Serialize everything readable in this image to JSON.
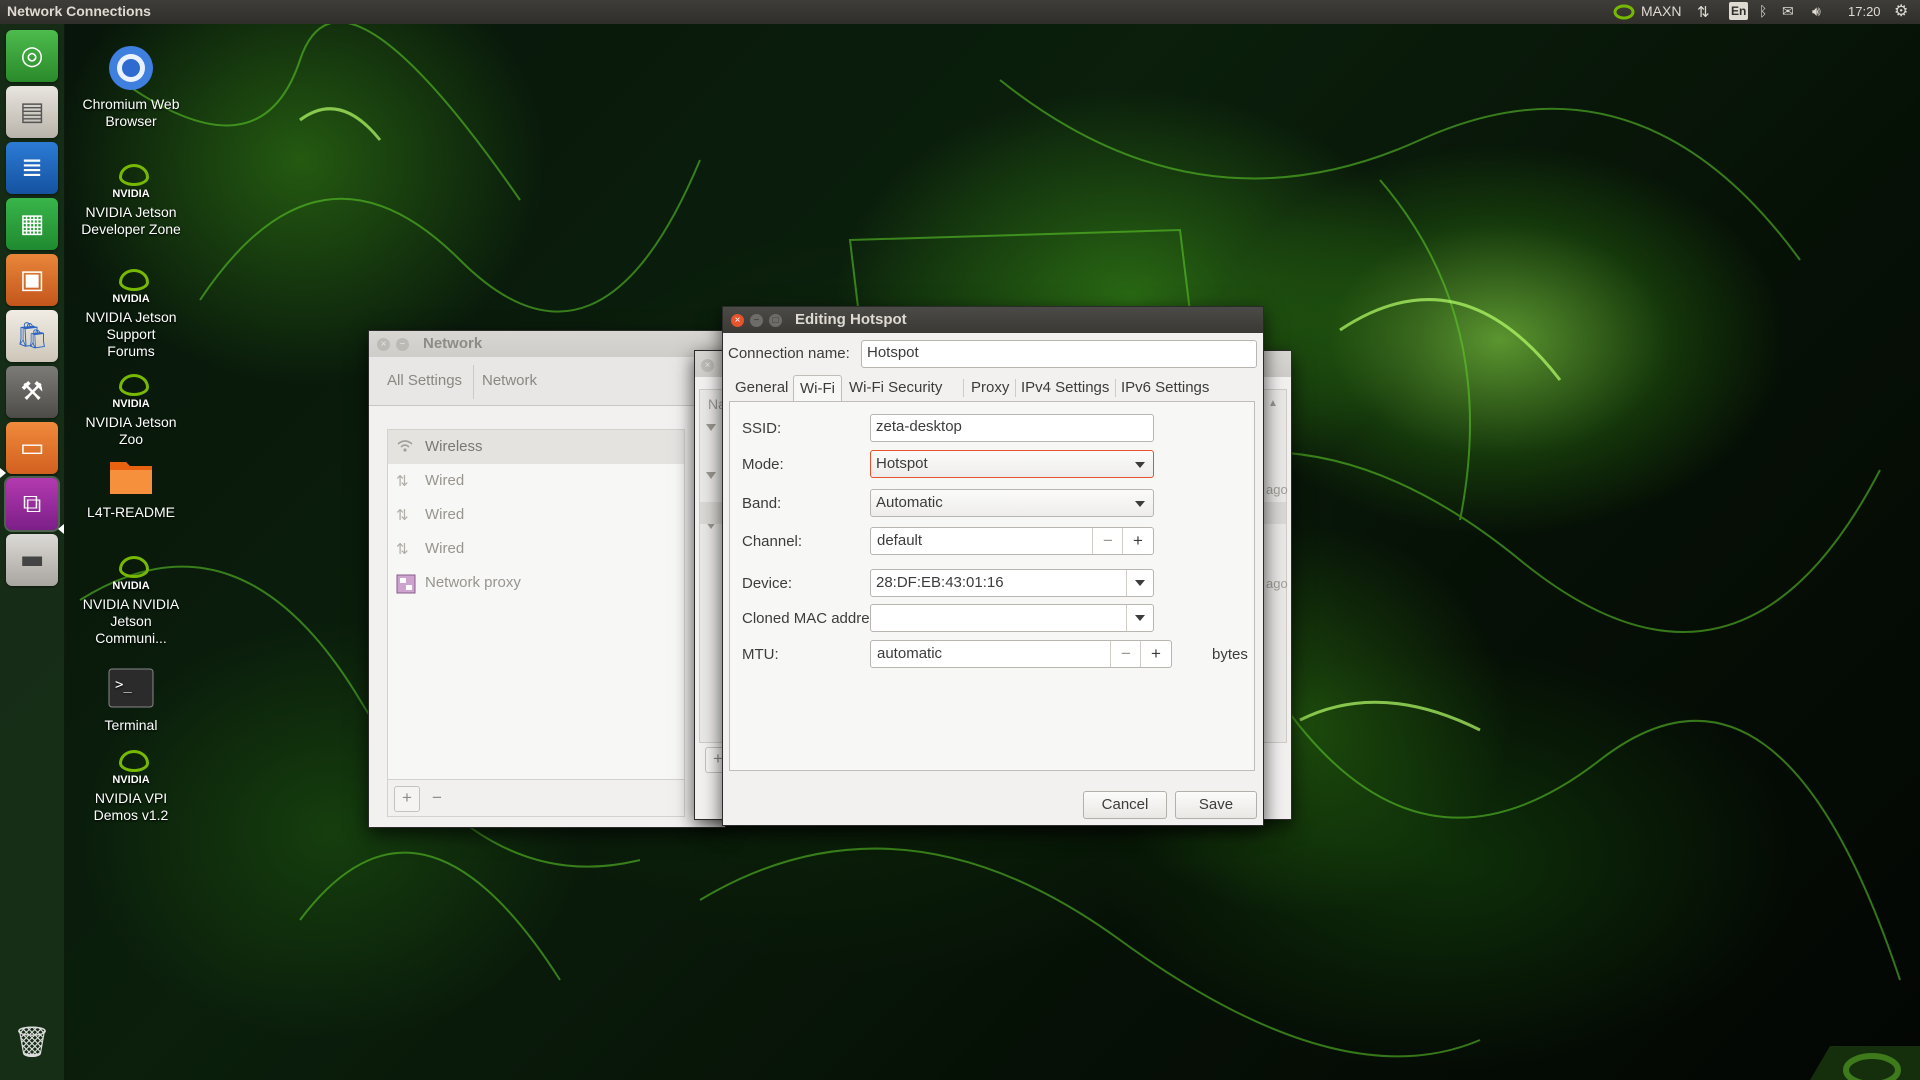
{
  "top_panel": {
    "app_title": "Network Connections",
    "power_mode": "MAXN",
    "keyboard_layout": "En",
    "clock": "17:20",
    "icons": [
      "nvidia-icon",
      "network-updown-icon",
      "keyboard-icon",
      "bluetooth-icon",
      "mail-icon",
      "volume-icon",
      "gear-icon"
    ]
  },
  "launcher": {
    "items": [
      "ubuntu-dash",
      "file-cabinet",
      "writer",
      "calc",
      "impress",
      "software-center",
      "system-settings",
      "file-manager",
      "network-connections",
      "drive"
    ],
    "trash": "trash"
  },
  "desktop_icons": [
    {
      "label": "Chromium Web Browser",
      "icon": "chromium-icon"
    },
    {
      "label": "NVIDIA Jetson Developer Zone",
      "icon": "nvidia-icon"
    },
    {
      "label": "NVIDIA Jetson Support Forums",
      "icon": "nvidia-icon"
    },
    {
      "label": "NVIDIA Jetson Zoo",
      "icon": "nvidia-icon"
    },
    {
      "label": "L4T-README",
      "icon": "folder-icon"
    },
    {
      "label": "NVIDIA NVIDIA Jetson Communi...",
      "icon": "nvidia-icon"
    },
    {
      "label": "Terminal",
      "icon": "terminal-icon"
    },
    {
      "label": "NVIDIA VPI Demos v1.2",
      "icon": "nvidia-icon"
    }
  ],
  "network_window": {
    "title": "Network",
    "breadcrumbs": [
      "All Settings",
      "Network"
    ],
    "devices": [
      {
        "label": "Wireless",
        "icon": "wifi-icon"
      },
      {
        "label": "Wired",
        "icon": "wired-icon"
      },
      {
        "label": "Wired",
        "icon": "wired-icon"
      },
      {
        "label": "Wired",
        "icon": "wired-icon"
      },
      {
        "label": "Network proxy",
        "icon": "proxy-icon"
      }
    ],
    "add_label": "+",
    "remove_label": "−"
  },
  "connections_window": {
    "partial_labels": [
      "Na",
      "ago",
      "ago"
    ]
  },
  "edit_window": {
    "title": "Editing Hotspot",
    "connection_name_label": "Connection name:",
    "connection_name_value": "Hotspot",
    "tabs": [
      "General",
      "Wi-Fi",
      "Wi-Fi Security",
      "Proxy",
      "IPv4 Settings",
      "IPv6 Settings"
    ],
    "active_tab": "Wi-Fi",
    "fields": {
      "ssid_label": "SSID:",
      "ssid_value": "zeta-desktop",
      "mode_label": "Mode:",
      "mode_value": "Hotspot",
      "band_label": "Band:",
      "band_value": "Automatic",
      "channel_label": "Channel:",
      "channel_value": "default",
      "device_label": "Device:",
      "device_value": "28:DF:EB:43:01:16",
      "cloned_mac_label": "Cloned MAC address:",
      "cloned_mac_value": "",
      "mtu_label": "MTU:",
      "mtu_value": "automatic",
      "mtu_unit": "bytes"
    },
    "minus": "−",
    "plus": "+",
    "cancel_label": "Cancel",
    "save_label": "Save"
  },
  "colors": {
    "accent_error": "#e6532c",
    "nvidia_green": "#76b900"
  }
}
